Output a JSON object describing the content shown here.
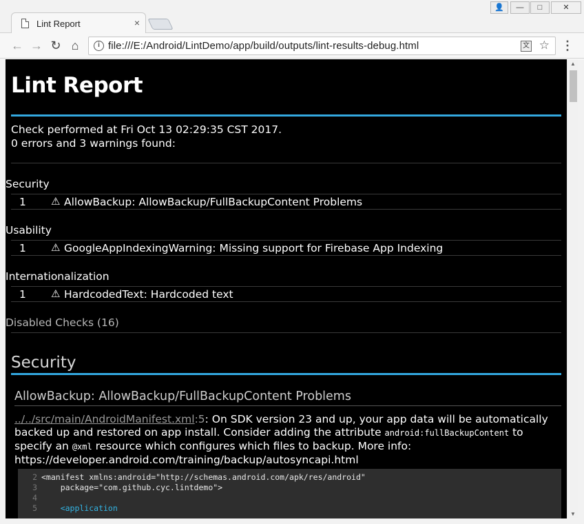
{
  "browser": {
    "tab_title": "Lint Report",
    "tab_close": "×",
    "url": "file:///E:/Android/LintDemo/app/build/outputs/lint-results-debug.html",
    "info_glyph": "i",
    "translate_glyph": "文",
    "star_glyph": "☆",
    "menu_glyph": "⋮",
    "back_glyph": "←",
    "forward_glyph": "→",
    "reload_glyph": "↻",
    "home_glyph": "⌂",
    "win_user_glyph": "👤",
    "win_min_glyph": "—",
    "win_max_glyph": "□",
    "win_close_glyph": "✕"
  },
  "report": {
    "title": "Lint Report",
    "check_line": "Check performed at Fri Oct 13 02:29:35 CST 2017.",
    "summary_line": "0 errors and 3 warnings found:",
    "categories": [
      {
        "name": "Security",
        "count": "1",
        "issue": "AllowBackup: AllowBackup/FullBackupContent Problems"
      },
      {
        "name": "Usability",
        "count": "1",
        "issue": "GoogleAppIndexingWarning: Missing support for Firebase App Indexing"
      },
      {
        "name": "Internationalization",
        "count": "1",
        "issue": "HardcodedText: Hardcoded text"
      }
    ],
    "warn_glyph": "⚠",
    "disabled_checks": "Disabled Checks (16)",
    "section_title": "Security",
    "issue_title": "AllowBackup: AllowBackup/FullBackupContent Problems",
    "desc": {
      "path_prefix": "../../src/main/",
      "path_file": "AndroidManifest.xml",
      "line_ref": ":5",
      "text1": ": On SDK version 23 and up, your app data will be automatically backed up and restored on app install. Consider adding the attribute ",
      "code1": "android:fullBackupContent",
      "text2": " to specify an ",
      "code2": "@xml",
      "text3": " resource which configures which files to backup. More info:",
      "url": "https://developer.android.com/training/backup/autosyncapi.html"
    },
    "code_lines": [
      {
        "num": "2",
        "text": "<manifest xmlns:android=\"http://schemas.android.com/apk/res/android\""
      },
      {
        "num": "3",
        "text": "    package=\"com.github.cyc.lintdemo\">"
      },
      {
        "num": "4",
        "text": ""
      },
      {
        "num": "5",
        "text": "    <application"
      }
    ]
  },
  "colors": {
    "accent": "#33a8e0",
    "background": "#000000",
    "code_bg": "#2e2e2e"
  }
}
